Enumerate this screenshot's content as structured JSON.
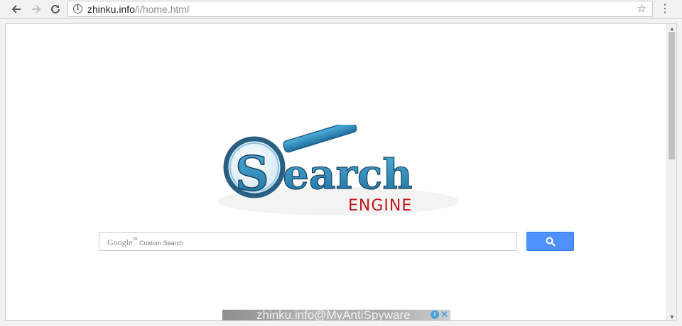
{
  "browser": {
    "url_host": "zhinku.info",
    "url_path": "/i/home.html",
    "icons": {
      "back": "arrow-left-icon",
      "forward": "arrow-right-icon",
      "reload": "reload-icon",
      "info": "info-icon",
      "bookmark": "star-icon",
      "menu": "kebab-menu-icon"
    }
  },
  "logo": {
    "word": "earch",
    "initial": "S",
    "subtitle": "ENGINE",
    "colors": {
      "primary": "#2b86b8",
      "dark": "#1d5f86",
      "subtitle": "#c0161c"
    }
  },
  "search": {
    "brand": "Google",
    "tm": "TM",
    "placeholder_rest": "Custom Search",
    "button_color": "#4d90fe"
  },
  "ad": {
    "watermark": "zhinku.info@MyAntiSpyware",
    "choices_label": "i",
    "close_label": "✕"
  }
}
